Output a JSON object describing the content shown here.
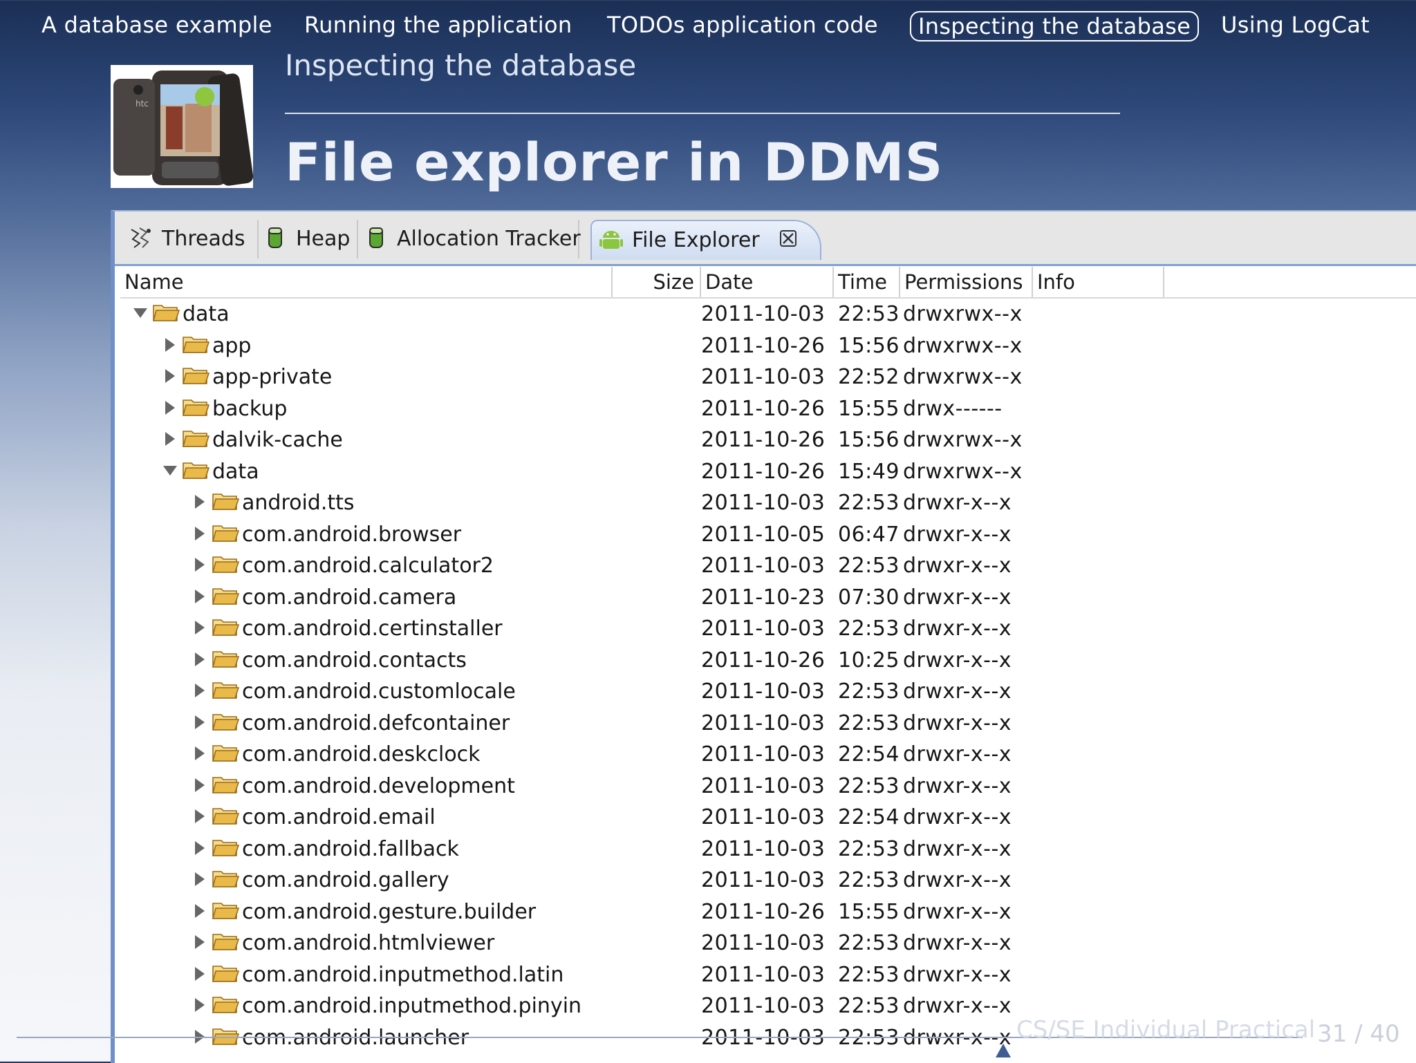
{
  "nav": {
    "items": [
      {
        "label": "A database example"
      },
      {
        "label": "Running the application"
      },
      {
        "label": "TODOs application code"
      },
      {
        "label": "Inspecting the database"
      },
      {
        "label": "Using LogCat"
      }
    ],
    "active_index": 3
  },
  "slide": {
    "subtitle": "Inspecting the database",
    "title": "File explorer in DDMS"
  },
  "ddms": {
    "tabs": [
      {
        "label": "Threads",
        "icon": "threads-icon"
      },
      {
        "label": "Heap",
        "icon": "heap-icon"
      },
      {
        "label": "Allocation Tracker",
        "icon": "allocation-tracker-icon"
      },
      {
        "label": "File Explorer",
        "icon": "android-icon"
      }
    ],
    "active_tab": "File Explorer",
    "columns": [
      "Name",
      "Size",
      "Date",
      "Time",
      "Permissions",
      "Info"
    ],
    "rows": [
      {
        "name": "data",
        "expanded": true,
        "date": "2011-10-03",
        "time": "22:53",
        "perm": "drwxrwx--x"
      },
      {
        "name": "app",
        "expanded": false,
        "date": "2011-10-26",
        "time": "15:56",
        "perm": "drwxrwx--x"
      },
      {
        "name": "app-private",
        "expanded": false,
        "date": "2011-10-03",
        "time": "22:52",
        "perm": "drwxrwx--x"
      },
      {
        "name": "backup",
        "expanded": false,
        "date": "2011-10-26",
        "time": "15:55",
        "perm": "drwx------"
      },
      {
        "name": "dalvik-cache",
        "expanded": false,
        "date": "2011-10-26",
        "time": "15:56",
        "perm": "drwxrwx--x"
      },
      {
        "name": "data",
        "expanded": true,
        "date": "2011-10-26",
        "time": "15:49",
        "perm": "drwxrwx--x"
      },
      {
        "name": "android.tts",
        "expanded": false,
        "date": "2011-10-03",
        "time": "22:53",
        "perm": "drwxr-x--x"
      },
      {
        "name": "com.android.browser",
        "expanded": false,
        "date": "2011-10-05",
        "time": "06:47",
        "perm": "drwxr-x--x"
      },
      {
        "name": "com.android.calculator2",
        "expanded": false,
        "date": "2011-10-03",
        "time": "22:53",
        "perm": "drwxr-x--x"
      },
      {
        "name": "com.android.camera",
        "expanded": false,
        "date": "2011-10-23",
        "time": "07:30",
        "perm": "drwxr-x--x"
      },
      {
        "name": "com.android.certinstaller",
        "expanded": false,
        "date": "2011-10-03",
        "time": "22:53",
        "perm": "drwxr-x--x"
      },
      {
        "name": "com.android.contacts",
        "expanded": false,
        "date": "2011-10-26",
        "time": "10:25",
        "perm": "drwxr-x--x"
      },
      {
        "name": "com.android.customlocale",
        "expanded": false,
        "date": "2011-10-03",
        "time": "22:53",
        "perm": "drwxr-x--x"
      },
      {
        "name": "com.android.defcontainer",
        "expanded": false,
        "date": "2011-10-03",
        "time": "22:53",
        "perm": "drwxr-x--x"
      },
      {
        "name": "com.android.deskclock",
        "expanded": false,
        "date": "2011-10-03",
        "time": "22:54",
        "perm": "drwxr-x--x"
      },
      {
        "name": "com.android.development",
        "expanded": false,
        "date": "2011-10-03",
        "time": "22:53",
        "perm": "drwxr-x--x"
      },
      {
        "name": "com.android.email",
        "expanded": false,
        "date": "2011-10-03",
        "time": "22:54",
        "perm": "drwxr-x--x"
      },
      {
        "name": "com.android.fallback",
        "expanded": false,
        "date": "2011-10-03",
        "time": "22:53",
        "perm": "drwxr-x--x"
      },
      {
        "name": "com.android.gallery",
        "expanded": false,
        "date": "2011-10-03",
        "time": "22:53",
        "perm": "drwxr-x--x"
      },
      {
        "name": "com.android.gesture.builder",
        "expanded": false,
        "date": "2011-10-26",
        "time": "15:55",
        "perm": "drwxr-x--x"
      },
      {
        "name": "com.android.htmlviewer",
        "expanded": false,
        "date": "2011-10-03",
        "time": "22:53",
        "perm": "drwxr-x--x"
      },
      {
        "name": "com.android.inputmethod.latin",
        "expanded": false,
        "date": "2011-10-03",
        "time": "22:53",
        "perm": "drwxr-x--x"
      },
      {
        "name": "com.android.inputmethod.pinyin",
        "expanded": false,
        "date": "2011-10-03",
        "time": "22:53",
        "perm": "drwxr-x--x"
      },
      {
        "name": "com.android.launcher",
        "expanded": false,
        "date": "2011-10-03",
        "time": "22:53",
        "perm": "drwxr-x--x"
      }
    ]
  },
  "footer": {
    "course": "CS/SE Individual Practical",
    "page": "31 / 40"
  },
  "colors": {
    "nav_bg": "#1b2f55",
    "window_accent": "#7fa0d6",
    "folder": "#e9b94a"
  }
}
